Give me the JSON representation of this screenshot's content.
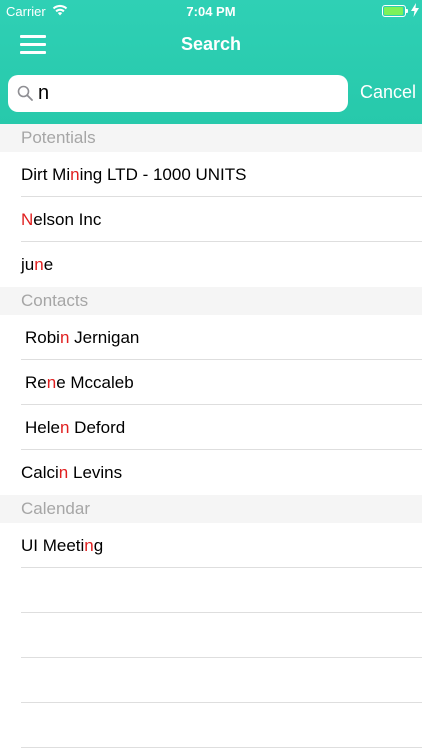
{
  "status_bar": {
    "carrier": "Carrier",
    "time": "7:04 PM"
  },
  "nav": {
    "title": "Search"
  },
  "search": {
    "value": "n",
    "cancel_label": "Cancel"
  },
  "colors": {
    "accent": "#27c9ab",
    "highlight": "#e02020",
    "section_text": "#a6a6a6"
  },
  "sections": [
    {
      "title": "Potentials",
      "rows": [
        {
          "parts": [
            "Dirt Mi",
            "n",
            "ing LTD - 1000 UNITS"
          ]
        },
        {
          "parts": [
            "",
            "N",
            "elson Inc"
          ]
        },
        {
          "parts": [
            "ju",
            "n",
            "e"
          ]
        }
      ]
    },
    {
      "title": "Contacts",
      "rows": [
        {
          "parts": [
            "Robi",
            "n",
            " Jernigan"
          ]
        },
        {
          "parts": [
            "Re",
            "n",
            "e Mccaleb"
          ]
        },
        {
          "parts": [
            "Hele",
            "n",
            " Deford"
          ]
        },
        {
          "parts": [
            "Calci",
            "n",
            " Levins"
          ]
        }
      ]
    },
    {
      "title": "Calendar",
      "rows": [
        {
          "parts": [
            "UI Meeti",
            "n",
            "g"
          ]
        }
      ]
    }
  ]
}
